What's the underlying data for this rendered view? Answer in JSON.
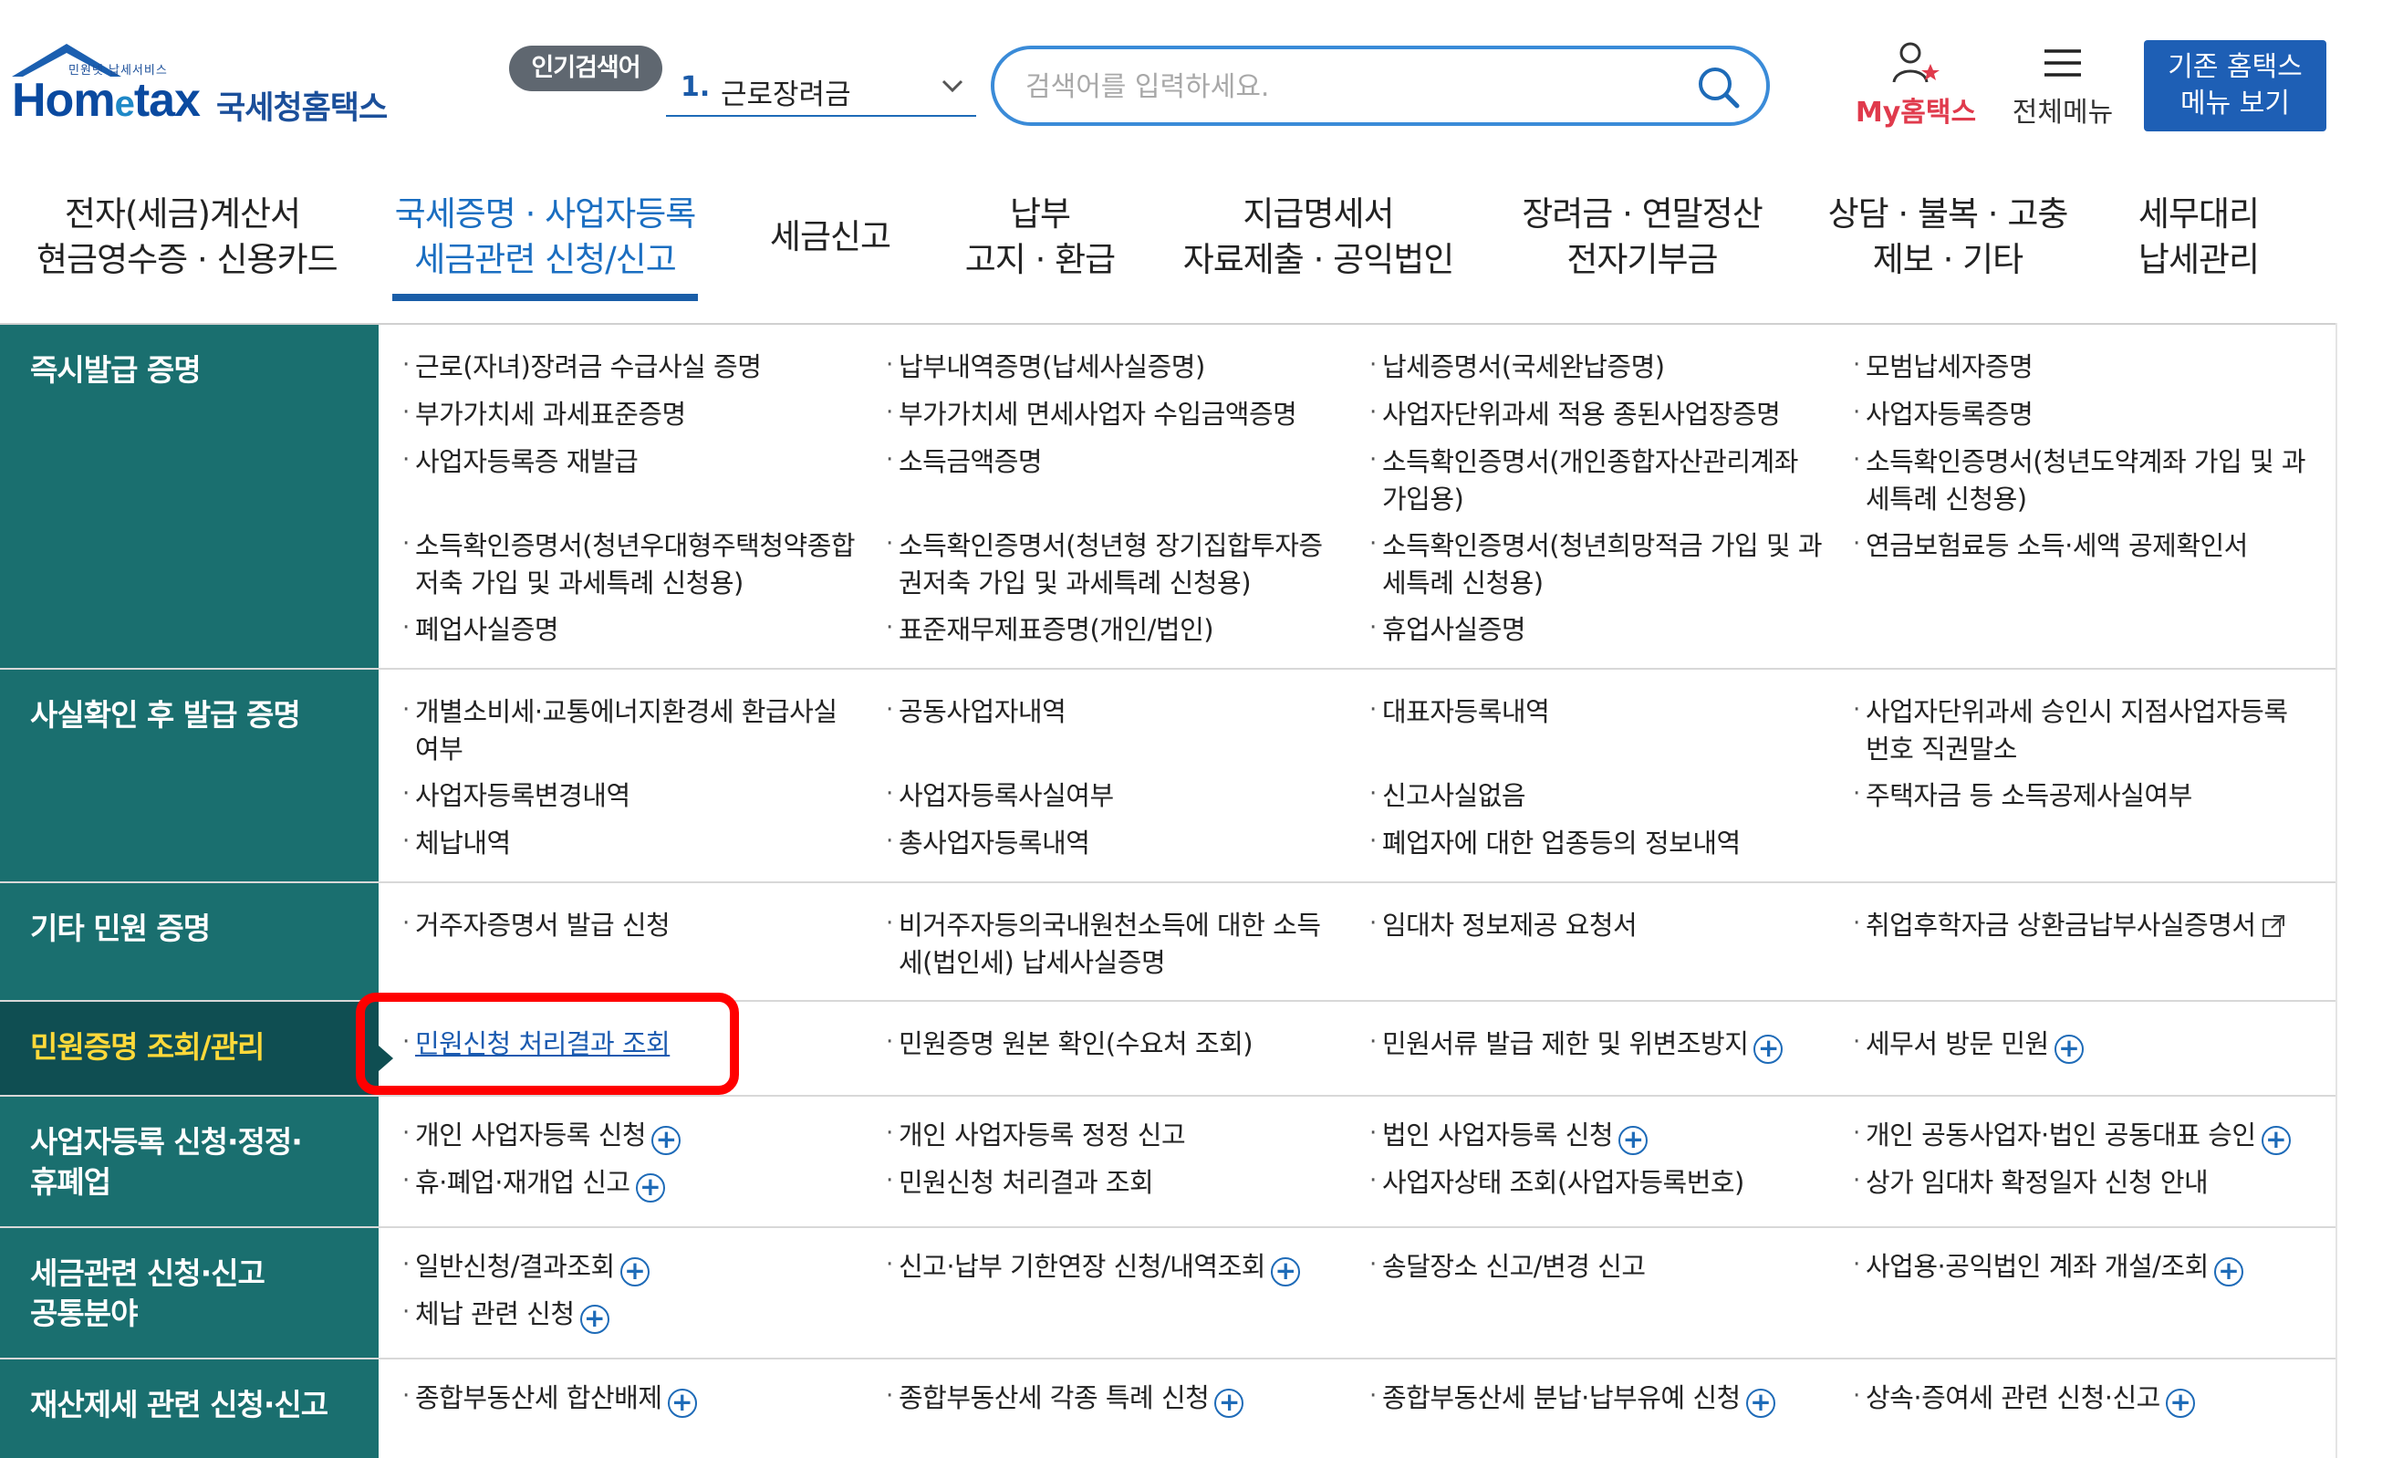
{
  "logo": {
    "small_text": "민원넷 납세서비스",
    "word_part1": "Hom",
    "word_e": "e",
    "word_part2": "tax",
    "korean": "국세청홈택스"
  },
  "popular": {
    "badge": "인기검색어",
    "rank": "1.",
    "keyword": "근로장려금"
  },
  "search": {
    "placeholder": "검색어를 입력하세요."
  },
  "utility": {
    "my_hometax": "My홈택스",
    "all_menu": "전체메뉴",
    "old_menu_line1": "기존 홈택스",
    "old_menu_line2": "메뉴 보기"
  },
  "gnb": [
    {
      "line1": "전자(세금)계산서",
      "line2": "현금영수증 · 신용카드"
    },
    {
      "line1": "국세증명 · 사업자등록",
      "line2": "세금관련 신청/신고"
    },
    {
      "line1": "세금신고",
      "line2": ""
    },
    {
      "line1": "납부",
      "line2": "고지 · 환급"
    },
    {
      "line1": "지급명세서",
      "line2": "자료제출 · 공익법인"
    },
    {
      "line1": "장려금 · 연말정산",
      "line2": "전자기부금"
    },
    {
      "line1": "상담 · 불복 · 고충",
      "line2": "제보 · 기타"
    },
    {
      "line1": "세무대리",
      "line2": "납세관리"
    }
  ],
  "active_gnb": "국세증명 · 사업자등록 세금관련 신청/신고",
  "categories": {
    "c0": "즉시발급 증명",
    "c1": "사실확인 후 발급 증명",
    "c2": "기타 민원 증명",
    "c3": "민원증명 조회/관리",
    "c4_1": "사업자등록 신청·정정·",
    "c4_2": "휴폐업",
    "c5_1": "세금관련 신청·신고",
    "c5_2": "공통분야",
    "c6": "재산제세 관련 신청·신고"
  },
  "items": {
    "r0": {
      "a1": "근로(자녀)장려금 수급사실 증명",
      "a2": "부가가치세 과세표준증명",
      "a3": "사업자등록증 재발급",
      "a4_1": "소득확인증명서(청년우대형주택청약종합",
      "a4_2": "저축 가입 및 과세특례 신청용)",
      "a5": "폐업사실증명",
      "b1": "납부내역증명(납세사실증명)",
      "b2": "부가가치세 면세사업자 수입금액증명",
      "b3": "소득금액증명",
      "b4_1": "소득확인증명서(청년형 장기집합투자증",
      "b4_2": "권저축 가입 및 과세특례 신청용)",
      "b5": "표준재무제표증명(개인/법인)",
      "c1": "납세증명서(국세완납증명)",
      "c2": "사업자단위과세 적용 종된사업장증명",
      "c3_1": "소득확인증명서(개인종합자산관리계좌",
      "c3_2": "가입용)",
      "c4_1": "소득확인증명서(청년희망적금 가입 및 과",
      "c4_2": "세특례 신청용)",
      "c5": "휴업사실증명",
      "d1": "모범납세자증명",
      "d2": "사업자등록증명",
      "d3_1": "소득확인증명서(청년도약계좌 가입 및 과",
      "d3_2": "세특례 신청용)",
      "d4": "연금보험료등 소득·세액 공제확인서"
    },
    "r1": {
      "a1_1": "개별소비세·교통에너지환경세 환급사실",
      "a1_2": "여부",
      "a2": "사업자등록변경내역",
      "a3": "체납내역",
      "b1": "공동사업자내역",
      "b2": "사업자등록사실여부",
      "b3": "총사업자등록내역",
      "c1": "대표자등록내역",
      "c2": "신고사실없음",
      "c3": "폐업자에 대한 업종등의 정보내역",
      "d1_1": "사업자단위과세 승인시 지점사업자등록",
      "d1_2": "번호 직권말소",
      "d2": "주택자금 등 소득공제사실여부"
    },
    "r2": {
      "a1": "거주자증명서 발급 신청",
      "b1_1": "비거주자등의국내원천소득에 대한 소득",
      "b1_2": "세(법인세) 납세사실증명",
      "c1": "임대차 정보제공 요청서",
      "d1": "취업후학자금 상환금납부사실증명서"
    },
    "r3": {
      "a1": "민원신청 처리결과 조회",
      "b1": "민원증명 원본 확인(수요처 조회)",
      "c1": "민원서류 발급 제한 및 위변조방지",
      "d1": "세무서 방문 민원"
    },
    "r4": {
      "a1": "개인 사업자등록 신청",
      "a2": "휴·폐업·재개업 신고",
      "b1": "개인 사업자등록 정정 신고",
      "b2": "민원신청 처리결과 조회",
      "c1": "법인 사업자등록 신청",
      "c2": "사업자상태 조회(사업자등록번호)",
      "d1": "개인 공동사업자·법인 공동대표 승인",
      "d2": "상가 임대차 확정일자 신청 안내"
    },
    "r5": {
      "a1": "일반신청/결과조회",
      "a2": "체납 관련 신청",
      "b1": "신고·납부 기한연장 신청/내역조회",
      "c1": "송달장소 신고/변경 신고",
      "d1": "사업용·공익법인 계좌 개설/조회"
    },
    "r6": {
      "a1": "종합부동산세 합산배제",
      "b1": "종합부동산세 각종 특례 신청",
      "c1": "종합부동산세 분납·납부유예 신청",
      "d1": "상속·증여세 관련 신청·신고"
    }
  },
  "plus_symbol": "+",
  "colors": {
    "category_bg": "#1a6f6f",
    "category_selected_bg": "#0f4e52",
    "category_selected_text": "#ffd93a",
    "accent_blue": "#1e6bb8",
    "highlight": "#ff0000",
    "my_hometax": "#e03a4c"
  }
}
